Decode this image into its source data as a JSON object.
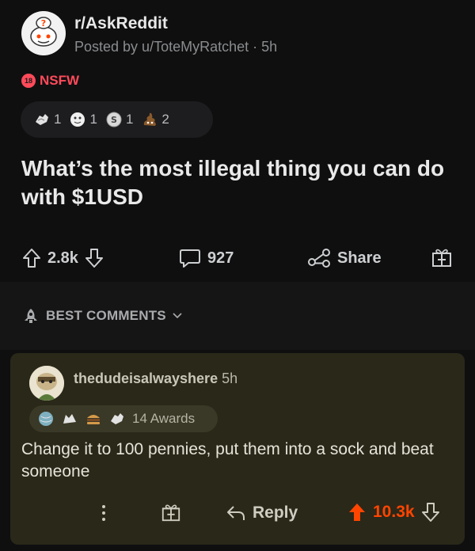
{
  "post": {
    "subreddit": "r/AskReddit",
    "posted_by": "Posted by u/ToteMyRatchet · 5h",
    "nsfw_badge": "18",
    "nsfw_label": "NSFW",
    "awards": [
      {
        "icon": "fist-award-icon",
        "count": "1"
      },
      {
        "icon": "face-award-icon",
        "count": "1"
      },
      {
        "icon": "coin-award-icon",
        "count": "1"
      },
      {
        "icon": "poop-award-icon",
        "count": "2"
      }
    ],
    "title": "What’s the most illegal thing you can do with $1USD",
    "votes": "2.8k",
    "comments": "927",
    "share_label": "Share"
  },
  "sort": {
    "label": "BEST COMMENTS"
  },
  "comment": {
    "author": "thedudeisalwayshere",
    "age": "5h",
    "awards_label": "14 Awards",
    "award_icons": [
      "globe-award-icon",
      "cat-award-icon",
      "burger-award-icon",
      "fist-award-icon"
    ],
    "body": "Change it to 100 pennies, put them into a sock and beat someone",
    "reply_label": "Reply",
    "votes": "10.3k"
  },
  "colors": {
    "upvote": "#ff4500",
    "nsfw": "#ff4a5a",
    "comment_bg": "#2a2819"
  }
}
